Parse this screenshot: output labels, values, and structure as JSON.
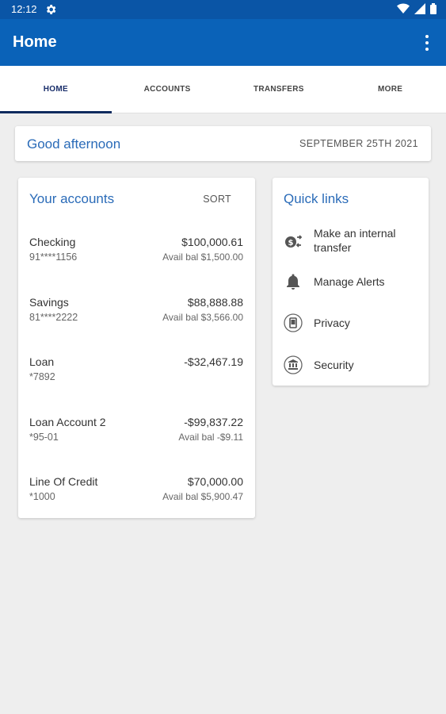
{
  "status_bar": {
    "time": "12:12"
  },
  "app_bar": {
    "title": "Home"
  },
  "tabs": [
    {
      "label": "HOME"
    },
    {
      "label": "ACCOUNTS"
    },
    {
      "label": "TRANSFERS"
    },
    {
      "label": "MORE"
    }
  ],
  "greeting": {
    "text": "Good afternoon",
    "date": "SEPTEMBER 25TH 2021"
  },
  "accounts": {
    "title": "Your accounts",
    "sort_label": "SORT",
    "items": [
      {
        "name": "Checking",
        "number": "91****1156",
        "amount": "$100,000.61",
        "avail": "Avail bal $1,500.00"
      },
      {
        "name": "Savings",
        "number": "81****2222",
        "amount": "$88,888.88",
        "avail": "Avail bal $3,566.00"
      },
      {
        "name": "Loan",
        "number": "*7892",
        "amount": "-$32,467.19",
        "avail": ""
      },
      {
        "name": "Loan Account 2",
        "number": "*95-01",
        "amount": "-$99,837.22",
        "avail": "Avail bal -$9.11"
      },
      {
        "name": "Line Of Credit",
        "number": "*1000",
        "amount": "$70,000.00",
        "avail": "Avail bal $5,900.47"
      }
    ]
  },
  "quick_links": {
    "title": "Quick links",
    "items": [
      {
        "label_line1": "Make an internal",
        "label_line2": "transfer",
        "icon": "transfer-icon"
      },
      {
        "label_line1": "Manage Alerts",
        "label_line2": "",
        "icon": "bell-icon"
      },
      {
        "label_line1": "Privacy",
        "label_line2": "",
        "icon": "privacy-icon"
      },
      {
        "label_line1": "Security",
        "label_line2": "",
        "icon": "security-icon"
      }
    ]
  }
}
